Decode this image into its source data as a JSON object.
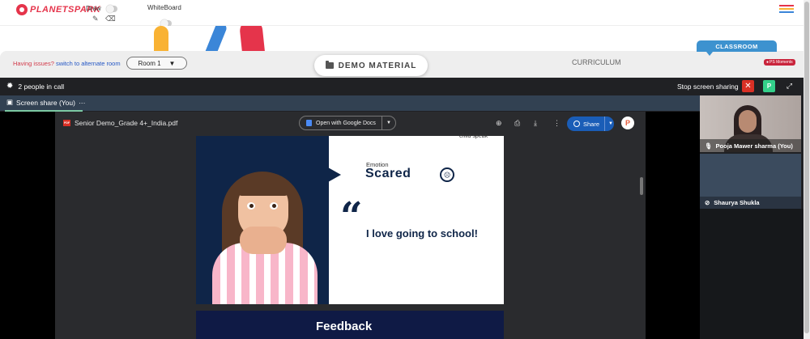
{
  "header": {
    "logo_text": "PLANETSPARK",
    "draw_label": "Draw",
    "whiteboard_label": "WhiteBoard",
    "hamburger_colors": [
      "#e5344b",
      "#f9b233",
      "#3b86d8",
      "#33b27c"
    ]
  },
  "room": {
    "issues_text": "Having issues?",
    "switch_link": "switch to alternate room",
    "room_select_value": "Room 1",
    "demo_material_label": "DEMO MATERIAL",
    "curriculum_label": "CURRICULUM",
    "classroom_tab": "CLASSROOM",
    "ps_moments_badge": "PS Moments"
  },
  "call": {
    "people_count_text": "2 people in call",
    "stop_sharing_label": "Stop screen sharing",
    "p_button_label": "P",
    "screen_share_tab": "Screen share (You)"
  },
  "pdf_viewer": {
    "file_name": "Senior Demo_Grade 4+_India.pdf",
    "open_with_label": "Open with Google Docs",
    "share_label": "Share",
    "avatar_letter": "P"
  },
  "slide": {
    "child_speak": "child speak",
    "emotion_label": "Emotion",
    "emotion_value": "Scared",
    "quote_mark": "“",
    "quote_text": "I love going to school!",
    "next_slide_title": "Feedback"
  },
  "participants": [
    {
      "name": "Pooja Mawer sharma (You)",
      "mic": "on"
    },
    {
      "name": "Shaurya Shukla",
      "mic": "muted"
    }
  ],
  "colors": {
    "brand_red": "#e5344b",
    "accent_blue": "#3d92cf",
    "call_bg": "#202124",
    "slide_navy": "#0f2548"
  }
}
